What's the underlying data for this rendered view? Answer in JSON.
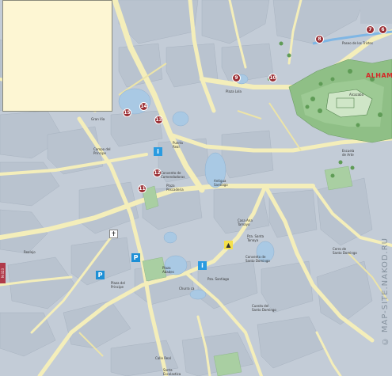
{
  "map": {
    "overlay_title": "ALHAM",
    "watermark": "© MAP-SITE.NAKOD.RU",
    "side_tag": "N-323",
    "markers": [
      {
        "id": "7",
        "label": "7"
      },
      {
        "id": "6",
        "label": "6"
      },
      {
        "id": "8",
        "label": "8"
      },
      {
        "id": "9",
        "label": "9"
      },
      {
        "id": "10",
        "label": "10"
      },
      {
        "id": "13",
        "label": "13"
      },
      {
        "id": "14",
        "label": "14"
      },
      {
        "id": "15",
        "label": "15"
      },
      {
        "id": "12",
        "label": "12"
      },
      {
        "id": "11",
        "label": "11"
      }
    ],
    "poi_icons": {
      "info1": "i",
      "info2": "i",
      "parking1": "P",
      "parking2": "P",
      "church": "✝",
      "shop": "▲"
    },
    "labels": {
      "alcazaba": "Alcazaba",
      "convento_comendadoras": "Convento de\nComendadoras",
      "antigua_santiago": "Antigua\nSantiago",
      "casa_ana_tamayo": "Casa Ana\nTamayo",
      "pza_santa_tanaya": "Pza. Santa\nTanaya",
      "convento_santo": "Convento de\nSanto Domingo",
      "plaza_abades": "Plaza\nAbades",
      "plaza_principe": "Plaza del\nPrincipe",
      "pza_santiago": "Pza. Santiago",
      "cuesta": "Cuesta del\nSanto Domingo",
      "churra": "Churra ca",
      "campo": "Campo del\nPrincipe",
      "gran_via": "Gran Via",
      "plaza_lola": "Plaza Lola",
      "cerro_santo": "Cerro de\nSanto Domingo",
      "escuela": "Escuela\nde Arte",
      "paseo": "Paseo de los Tristes",
      "puerta": "Puerta\nReal",
      "calle_real": "Calle Real",
      "plaza_pescaderia": "Plaza\nPescaderia",
      "santa_escolastica": "Santa\nEscolastica",
      "realejo": "Realejo"
    }
  }
}
